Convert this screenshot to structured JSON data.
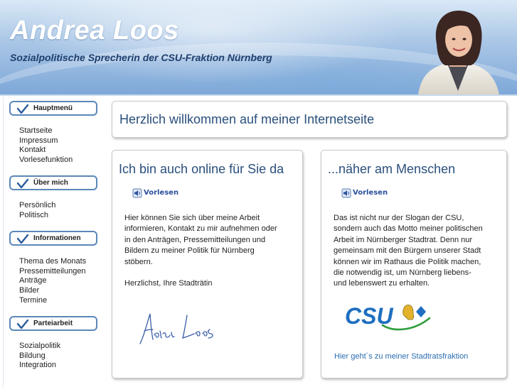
{
  "header": {
    "title": "Andrea Loos",
    "subtitle": "Sozialpolitische Sprecherin der CSU-Fraktion Nürnberg"
  },
  "sidebar": {
    "sections": [
      {
        "label": "Hauptmenü",
        "items": [
          "Startseite",
          "Impressum",
          "Kontakt",
          "Vorlesefunktion"
        ]
      },
      {
        "label": "Über mich",
        "items": [
          "Persönlich",
          "Politisch"
        ]
      },
      {
        "label": "Informationen",
        "items": [
          "Thema des Monats",
          "Pressemitteilungen",
          "Anträge",
          "Bilder",
          "Termine"
        ]
      },
      {
        "label": "Parteiarbeit",
        "items": [
          "Sozialpolitik",
          "Bildung",
          "Integration"
        ]
      }
    ]
  },
  "welcome": {
    "heading": "Herzlich willkommen auf meiner Internetseite"
  },
  "col1": {
    "heading": "Ich bin auch online für Sie da",
    "readaloud": "Vorlesen",
    "paragraph_lines": [
      "Hier können Sie sich über meine Arbeit",
      "informieren, Kontakt zu mir aufnehmen oder",
      "in den Anträgen, Pressemitteilungen und",
      "Bildern zu meiner Politik für Nürnberg",
      "stöbern."
    ],
    "closing": "Herzlichst, Ihre Stadträtin",
    "signature": "Andrea Loos"
  },
  "col2": {
    "heading": "...näher am Menschen",
    "readaloud": "Vorlesen",
    "paragraph_lines": [
      "Das ist nicht nur der Slogan der CSU,",
      "sondern auch das Motto meiner politischen",
      "Arbeit im Nürnberger Stadtrat. Denn nur",
      "gemeinsam mit den Bürgern unserer Stadt",
      "können wir im Rathaus die Politik machen,",
      "die notwendig ist, um Nürnberg liebens-",
      "und lebenswert zu erhalten."
    ],
    "logo_text": "CSU",
    "link": "Hier geht´s zu meiner Stadtratsfraktion"
  },
  "colors": {
    "heading_blue": "#2a4f7c",
    "menu_border": "#5b87b8",
    "link_blue": "#2a6db0",
    "csu_blue": "#1f6fc0",
    "csu_green": "#2f9d3c"
  },
  "icons": {
    "menu_check": "checkmark-icon",
    "readaloud": "speaker-icon"
  }
}
